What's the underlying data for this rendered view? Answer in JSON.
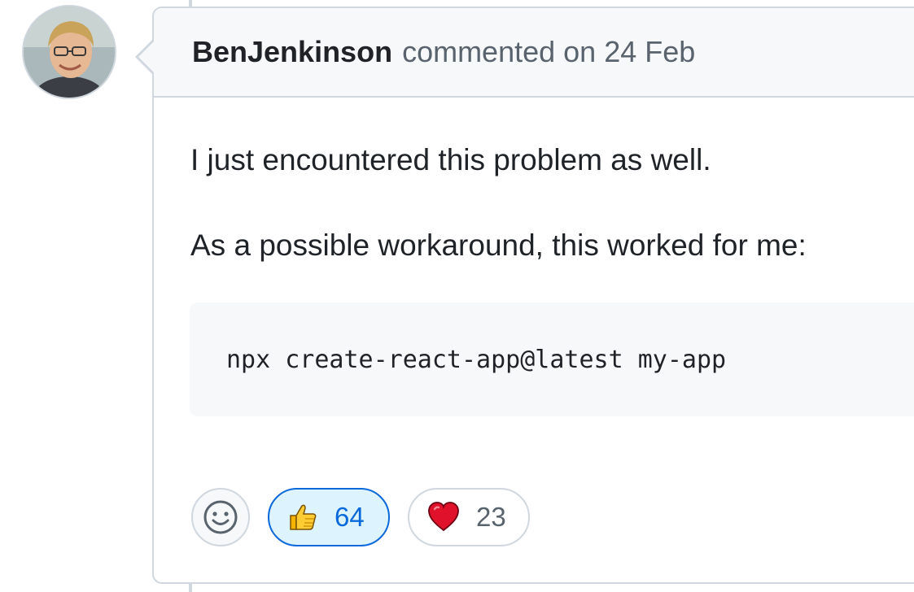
{
  "comment": {
    "author": "BenJenkinson",
    "meta": "commented on 24 Feb",
    "body": [
      "I just encountered this problem as well.",
      "As a possible workaround, this worked for me:"
    ],
    "code": "npx create-react-app@latest my-app"
  },
  "reactions": {
    "add_reaction_icon": "smiley-icon",
    "items": [
      {
        "icon": "thumbs-up-icon",
        "count": "64",
        "selected": true
      },
      {
        "icon": "heart-icon",
        "count": "23",
        "selected": false
      }
    ]
  },
  "colors": {
    "accent": "#0969da",
    "accent_bg": "#ddf4ff",
    "border": "#d0d7de",
    "header_bg": "#f6f8fa"
  }
}
